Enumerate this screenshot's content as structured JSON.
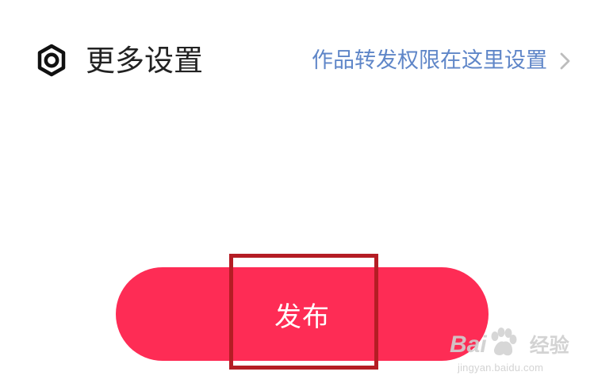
{
  "settings": {
    "title": "更多设置",
    "link_text": "作品转发权限在这里设置",
    "icon": "gear-icon",
    "link_icon": "chevron-right-icon"
  },
  "publish": {
    "label": "发布"
  },
  "watermark": {
    "brand": "Bai",
    "brand_cn": "经验",
    "url": "jingyan.baidu.com"
  },
  "colors": {
    "accent": "#fe2c55",
    "link": "#5f86c8",
    "highlight": "#b51d24",
    "text": "#222222"
  }
}
